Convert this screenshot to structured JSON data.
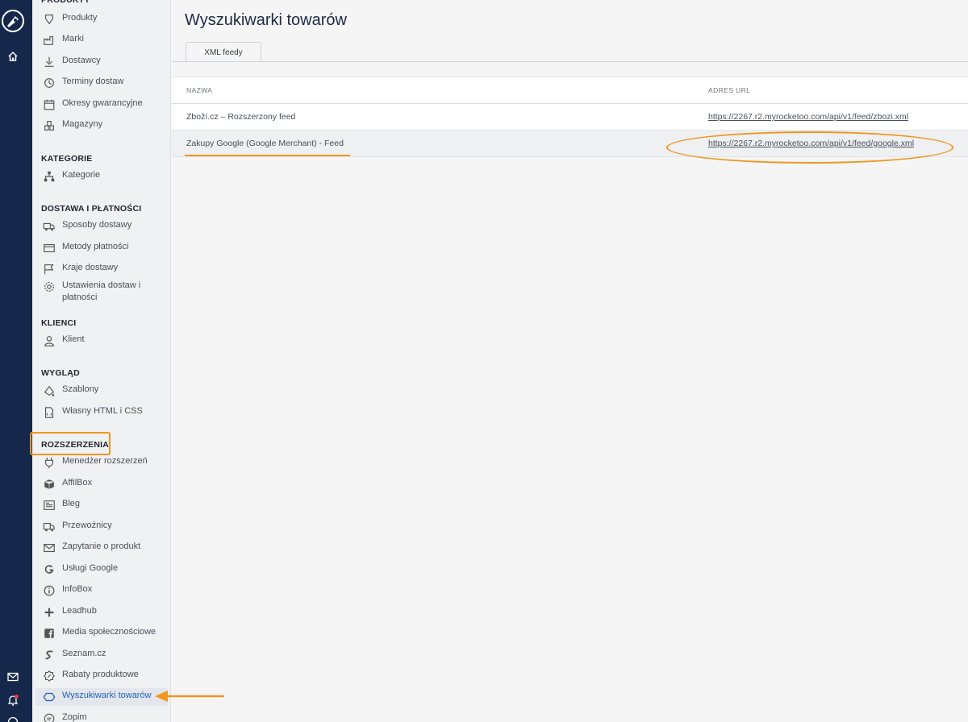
{
  "sidebar": {
    "sections": [
      {
        "title": "PRODUKTY",
        "items": [
          {
            "label": "Produkty",
            "icon": "product-icon"
          },
          {
            "label": "Marki",
            "icon": "factory-icon"
          },
          {
            "label": "Dostawcy",
            "icon": "supplier-icon"
          },
          {
            "label": "Terminy dostaw",
            "icon": "clock-icon"
          },
          {
            "label": "Okresy gwarancyjne",
            "icon": "calendar-icon"
          },
          {
            "label": "Magazyny",
            "icon": "warehouse-icon"
          }
        ]
      },
      {
        "title": "KATEGORIE",
        "items": [
          {
            "label": "Kategorie",
            "icon": "tree-icon"
          }
        ]
      },
      {
        "title": "DOSTAWA I PŁATNOŚCI",
        "items": [
          {
            "label": "Sposoby dostawy",
            "icon": "truck-icon"
          },
          {
            "label": "Metody płatności",
            "icon": "card-icon"
          },
          {
            "label": "Kraje dostawy",
            "icon": "flag-icon"
          },
          {
            "label": "Ustawienia dostaw i płatności",
            "icon": "gear-icon"
          }
        ]
      },
      {
        "title": "KLIENCI",
        "items": [
          {
            "label": "Klient",
            "icon": "user-icon"
          }
        ]
      },
      {
        "title": "WYGLĄD",
        "items": [
          {
            "label": "Szablony",
            "icon": "paint-icon"
          },
          {
            "label": "Własny HTML i CSS",
            "icon": "code-file-icon"
          }
        ]
      },
      {
        "title": "ROZSZERZENIA",
        "items": [
          {
            "label": "Menedżer rozszerzeń",
            "icon": "plug-icon"
          },
          {
            "label": "AffilBox",
            "icon": "box-icon"
          },
          {
            "label": "Bleg",
            "icon": "newspaper-icon"
          },
          {
            "label": "Przewoźnicy",
            "icon": "carrier-icon"
          },
          {
            "label": "Zapytanie o produkt",
            "icon": "mail-icon"
          },
          {
            "label": "Usługi Google",
            "icon": "google-icon"
          },
          {
            "label": "InfoBox",
            "icon": "info-icon"
          },
          {
            "label": "Leadhub",
            "icon": "plus-icon"
          },
          {
            "label": "Media społecznościowe",
            "icon": "facebook-icon"
          },
          {
            "label": "Seznam.cz",
            "icon": "seznam-icon"
          },
          {
            "label": "Rabaty produktowe",
            "icon": "discount-icon"
          },
          {
            "label": "Wyszukiwarki towarów",
            "icon": "hexagon-icon",
            "active": true
          },
          {
            "label": "Zopim",
            "icon": "chat-icon"
          }
        ]
      }
    ]
  },
  "main": {
    "title": "Wyszukiwarki towarów",
    "tabs": [
      {
        "label": "XML feedy",
        "active": true
      }
    ],
    "table": {
      "columns": [
        "NAZWA",
        "ADRES URL"
      ],
      "rows": [
        {
          "name": "Zboží.cz – Rozszerzony feed",
          "url": "https://2267.r2.myrocketoo.com/api/v1/feed/zbozi.xml"
        },
        {
          "name": "Zakupy Google (Google Merchant) - Feed",
          "url": "https://2267.r2.myrocketoo.com/api/v1/feed/google.xml"
        }
      ]
    }
  },
  "annotation_color": "#f0961e",
  "colors": {
    "rail": "#15274a",
    "active_text": "#1d5fbe",
    "notification_dot": "#e03a3a"
  }
}
